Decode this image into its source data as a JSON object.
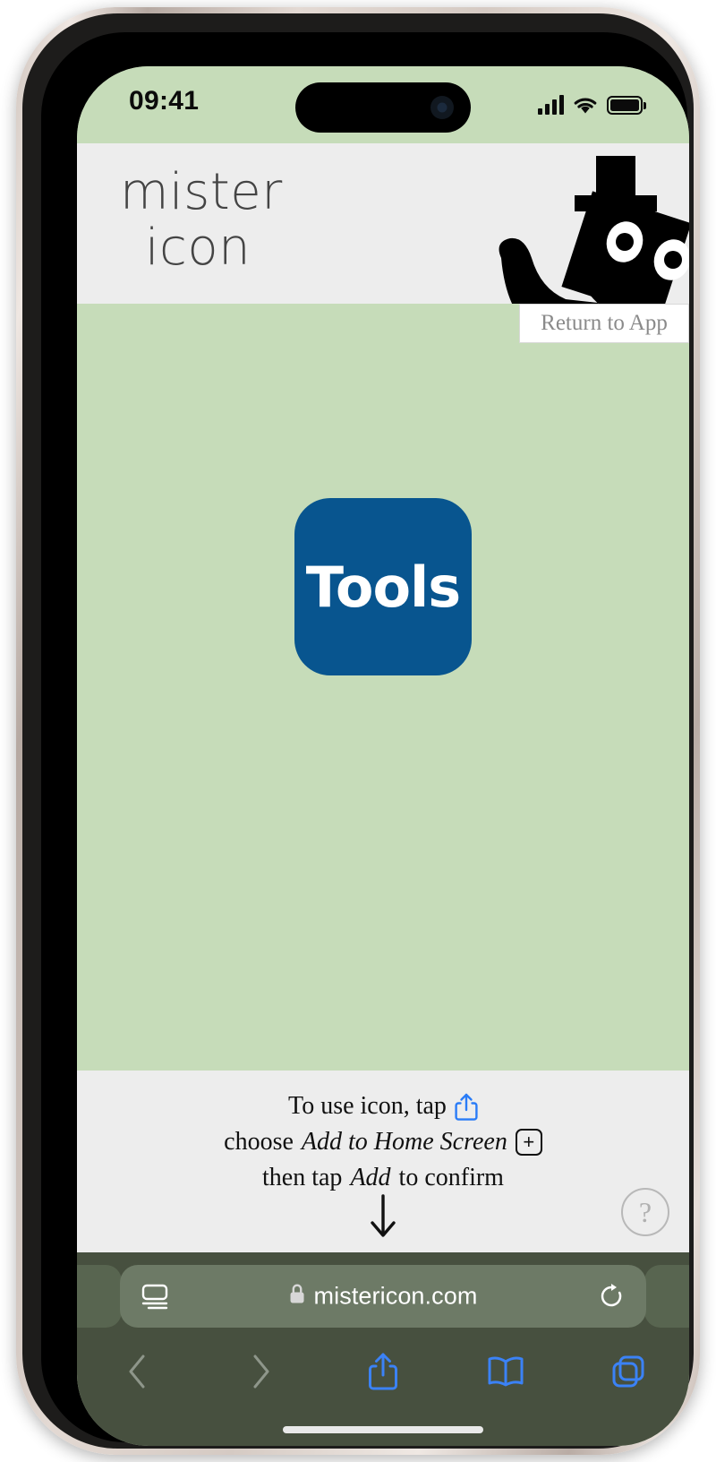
{
  "status_bar": {
    "time": "09:41",
    "signal_icon": "cellular-signal-icon",
    "wifi_icon": "wifi-icon",
    "battery_icon": "battery-icon"
  },
  "header": {
    "brand_line1": "mister",
    "brand_line2": "icon",
    "mascot_icon": "robot-mascot-icon"
  },
  "return_button": {
    "label": "Return to App"
  },
  "canvas": {
    "app_icon_label": "Tools",
    "app_icon_color": "#08558f",
    "background_color": "#c6dcb9"
  },
  "instructions": {
    "line1_prefix": "To use icon, tap",
    "line1_icon": "share-icon",
    "line2_prefix": "choose",
    "line2_emphasis": "Add to Home Screen",
    "line2_icon": "plus-box-icon",
    "line3_prefix": "then tap",
    "line3_emphasis": "Add",
    "line3_suffix": "to confirm",
    "arrow_icon": "arrow-down-icon",
    "help_label": "?"
  },
  "safari": {
    "url": "mistericon.com",
    "lock_icon": "lock-icon",
    "page_settings_icon": "page-settings-icon",
    "reload_icon": "reload-icon",
    "toolbar": [
      {
        "name": "back-button",
        "icon": "chevron-left-icon",
        "enabled": false
      },
      {
        "name": "forward-button",
        "icon": "chevron-right-icon",
        "enabled": false
      },
      {
        "name": "share-button",
        "icon": "share-icon",
        "enabled": true
      },
      {
        "name": "bookmarks-button",
        "icon": "book-icon",
        "enabled": true
      },
      {
        "name": "tabs-button",
        "icon": "tabs-icon",
        "enabled": true
      }
    ],
    "accent_color": "#3b82f6",
    "chrome_color": "#47503f"
  }
}
